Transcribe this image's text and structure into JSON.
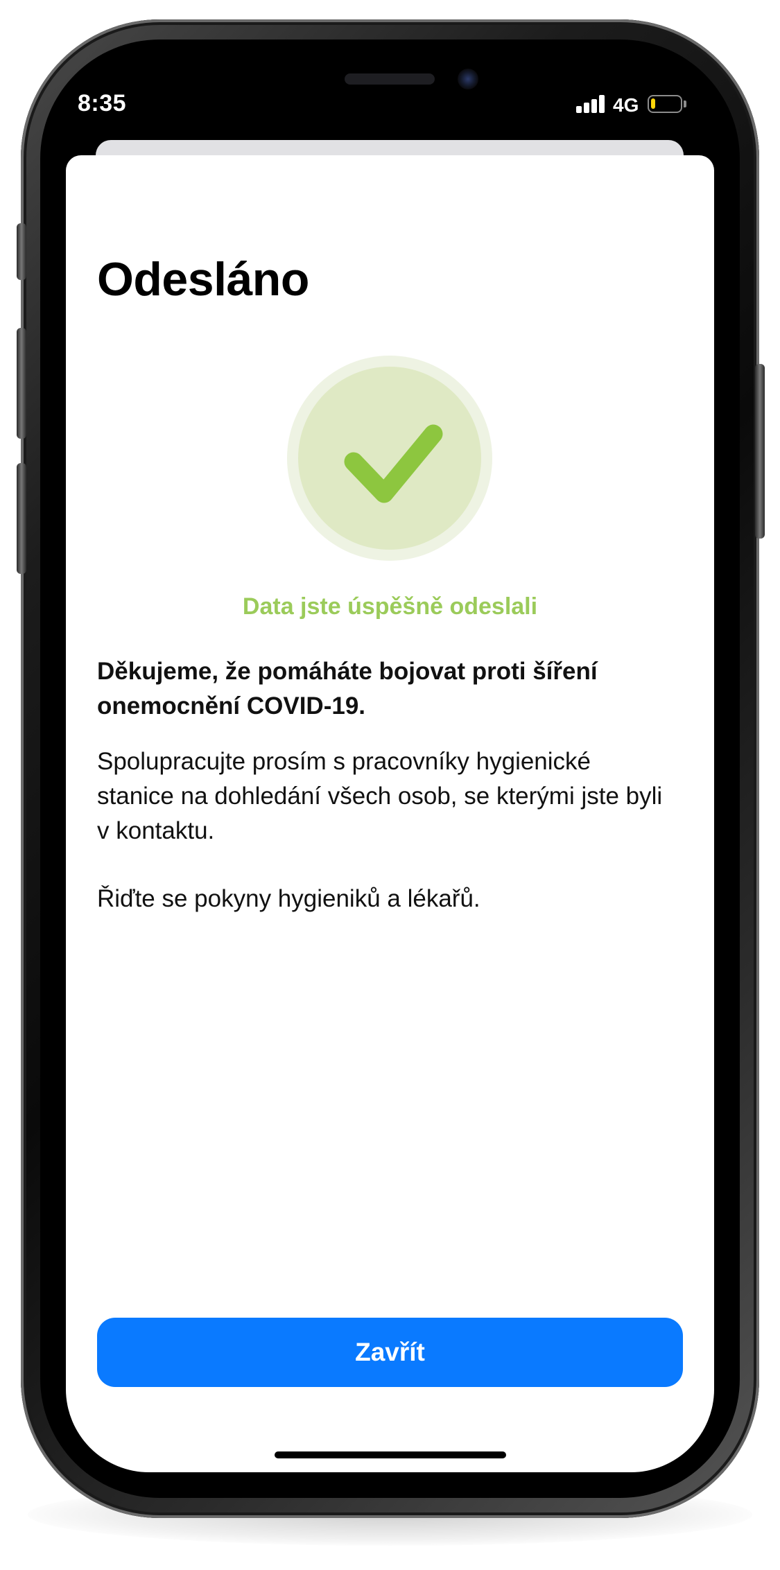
{
  "status_bar": {
    "time": "8:35",
    "network": "4G",
    "battery_level": 0.15,
    "battery_color": "#FFD60A",
    "signal_icon": "cellular-signal-icon"
  },
  "screen": {
    "title": "Odesláno",
    "success_icon": "checkmark-icon",
    "success_message": "Data jste úspěšně odeslali",
    "thanks": "Děkujeme, že pomáháte bojovat proti šíření onemocnění COVID-19.",
    "body": "Spolupracujte prosím s pracovníky hygienické stanice na dohledání všech osob, se kterými jste byli v kontaktu.",
    "instructions": "Řiďte se pokyny hygieniků a lékařů."
  },
  "actions": {
    "close_label": "Zavřít"
  },
  "colors": {
    "accent_blue": "#0A7AFF",
    "success_green": "#8DC63F",
    "success_text": "#9BCB5A",
    "circle_inner": "#DFE9C4",
    "circle_outer": "#EEF3E3"
  }
}
